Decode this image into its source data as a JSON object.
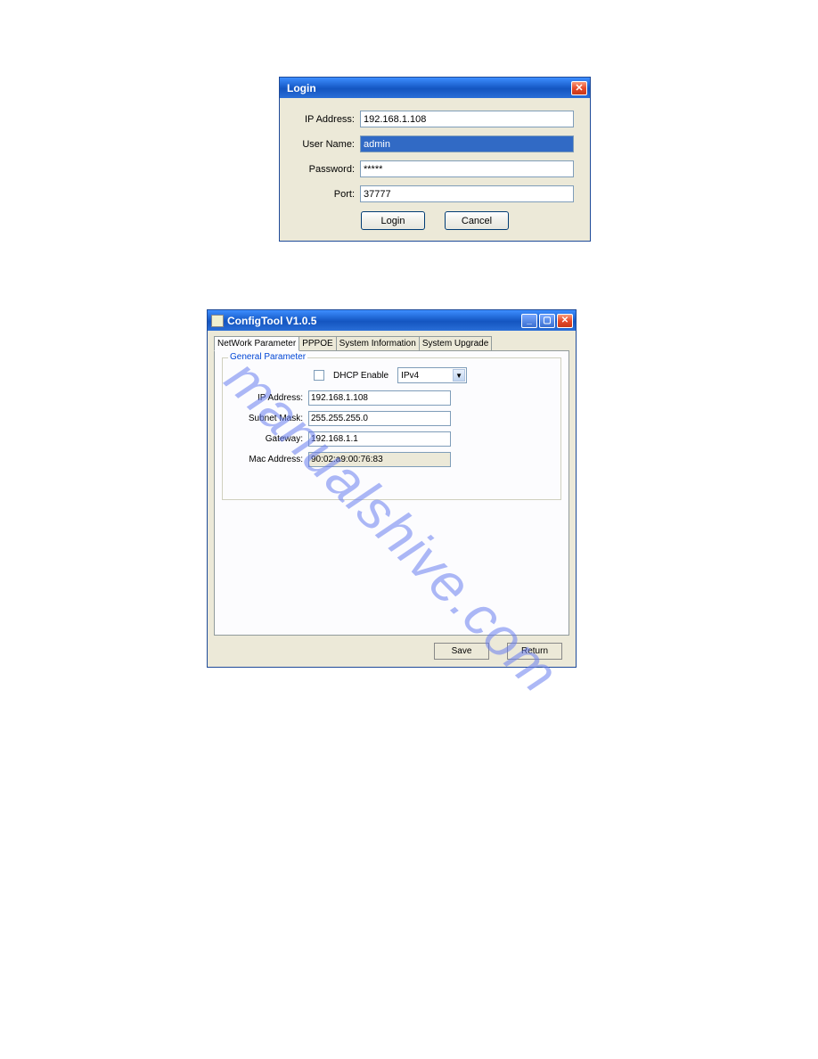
{
  "watermark": "manualshive.com",
  "loginDialog": {
    "title": "Login",
    "fields": {
      "ipAddressLabel": "IP Address:",
      "ipAddressValue": "192.168.1.108",
      "userNameLabel": "User Name:",
      "userNameValue": "admin",
      "passwordLabel": "Password:",
      "passwordValue": "*****",
      "portLabel": "Port:",
      "portValue": "37777"
    },
    "buttons": {
      "login": "Login",
      "cancel": "Cancel"
    }
  },
  "configWindow": {
    "title": "ConfigTool V1.0.5",
    "tabs": {
      "network": "NetWork Parameter",
      "pppoe": "PPPOE",
      "sysinfo": "System Information",
      "sysupgrade": "System Upgrade"
    },
    "general": {
      "legend": "General Parameter",
      "dhcpLabel": "DHCP Enable",
      "ipVersionValue": "IPv4",
      "ipAddressLabel": "IP Address:",
      "ipAddressValue": "192.168.1.108",
      "subnetMaskLabel": "Subnet Mask:",
      "subnetMaskValue": "255.255.255.0",
      "gatewayLabel": "Gateway:",
      "gatewayValue": "192.168.1.1",
      "macAddressLabel": "Mac Address:",
      "macAddressValue": "90:02:a9:00:76:83"
    },
    "buttons": {
      "save": "Save",
      "return": "Return"
    }
  }
}
